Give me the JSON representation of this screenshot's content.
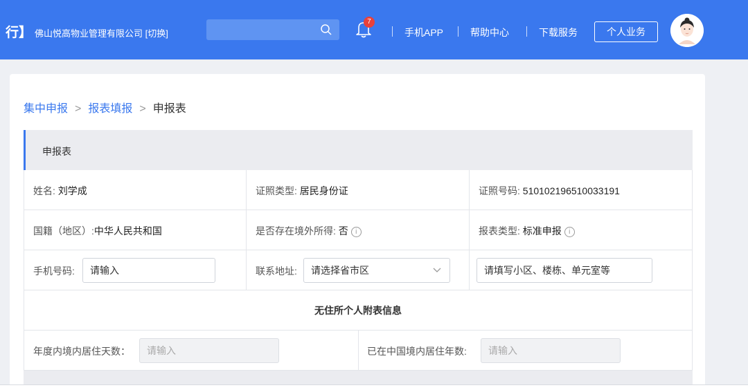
{
  "header": {
    "left_text": "行】",
    "company": "佛山悦高物业管理有限公司 [切换]",
    "search_placeholder": "",
    "notification_count": "7",
    "links": [
      "手机APP",
      "帮助中心",
      "下载服务"
    ],
    "personal_button": "个人业务",
    "brand_color": "#3a78ee"
  },
  "breadcrumb": {
    "items": [
      "集中申报",
      "报表填报",
      "申报表"
    ],
    "separator": ">"
  },
  "form": {
    "section_title": "申报表",
    "name_label": "姓名:",
    "name_value": "刘学成",
    "id_type_label": "证照类型:",
    "id_type_value": "居民身份证",
    "id_no_label": "证照号码:",
    "id_no_value": "510102196510033191",
    "nationality_label": "国籍（地区）:",
    "nationality_value": "中华人民共和国",
    "overseas_label": "是否存在境外所得:",
    "overseas_value": "否",
    "report_type_label": "报表类型:",
    "report_type_value": "标准申报",
    "phone_label": "手机号码:",
    "phone_value": "请输入",
    "address_label": "联系地址:",
    "address_select": "请选择省市区",
    "address_detail": "请填写小区、楼栋、单元室等",
    "nonresident_title": "无住所个人附表信息",
    "days_label": "年度内境内居住天数：",
    "days_placeholder": "请输入",
    "years_label": "已在中国境内居住年数:",
    "years_placeholder": "请输入",
    "info_icon": "i"
  }
}
